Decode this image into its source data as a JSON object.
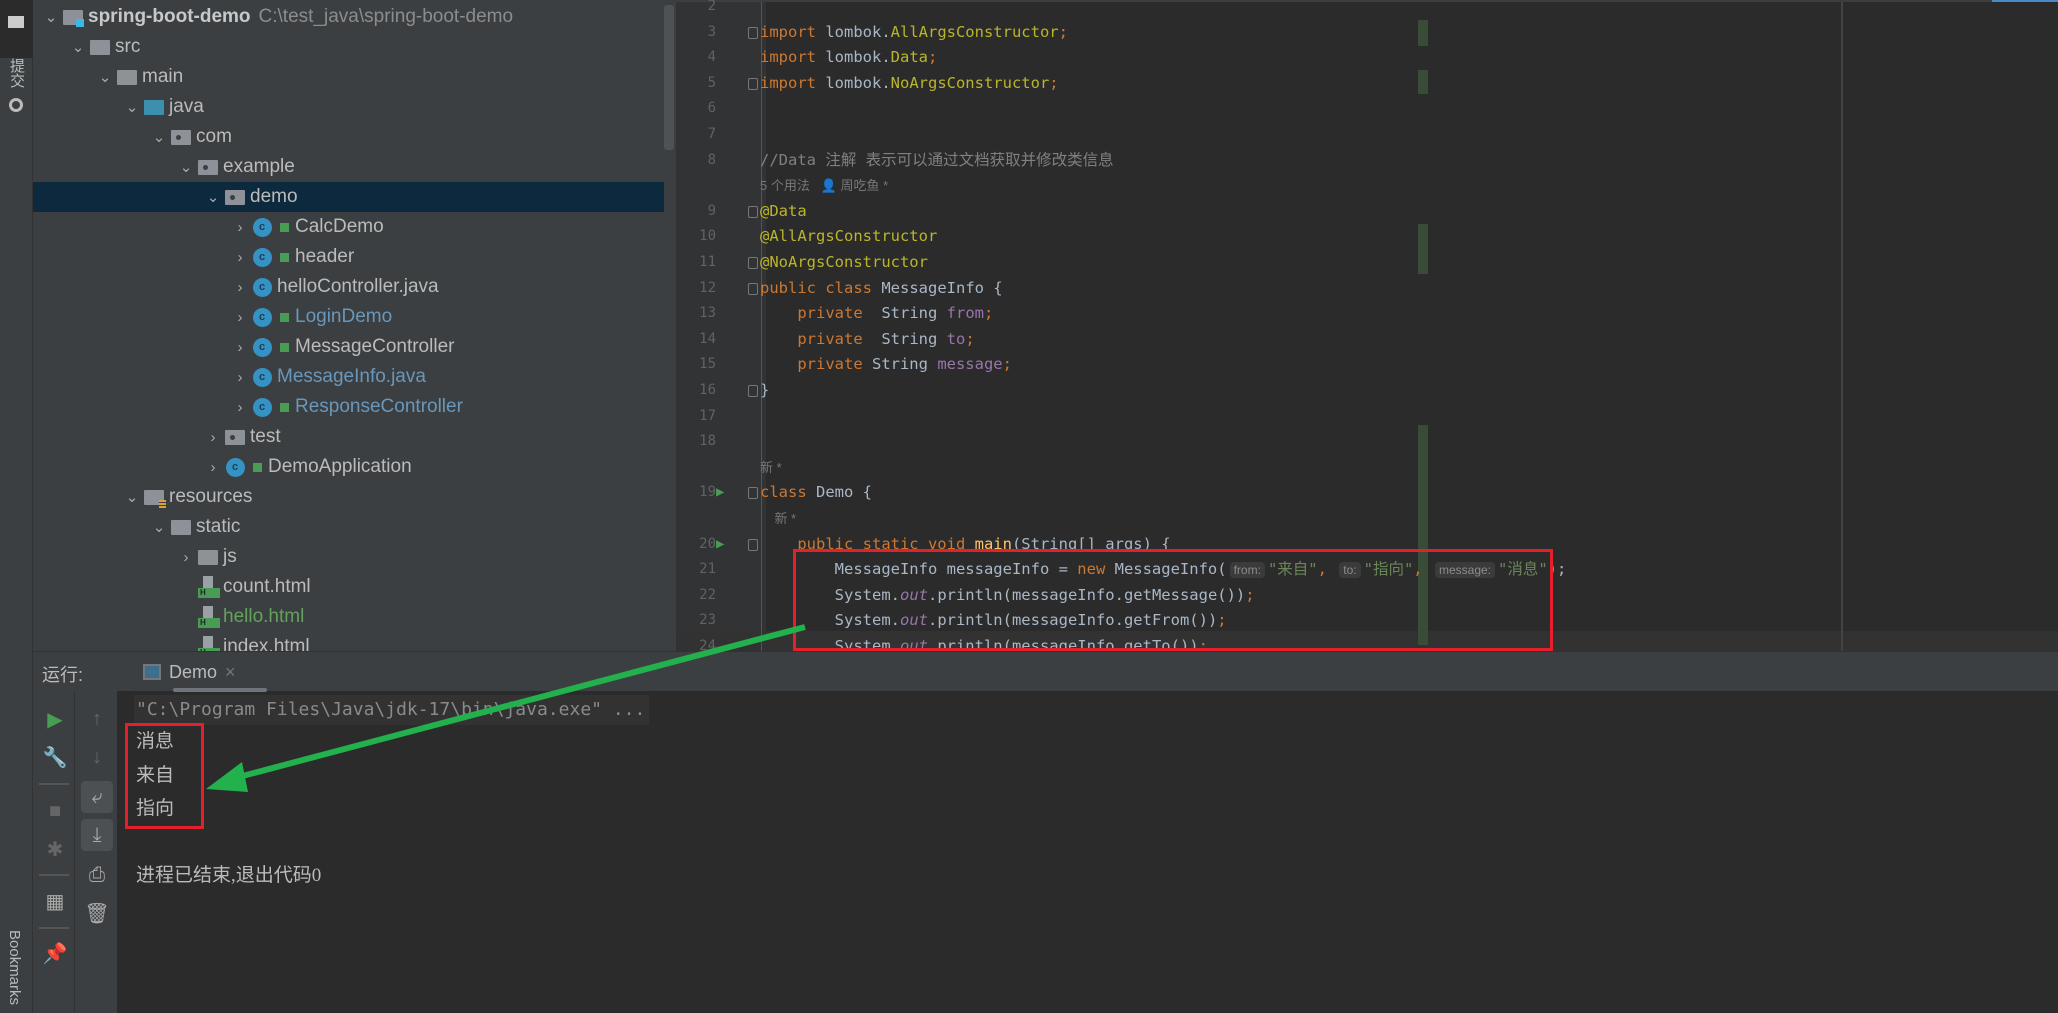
{
  "left_strip": {
    "project_label": "项目",
    "commit_label": "提交",
    "bookmarks_label": "Bookmarks"
  },
  "project": {
    "root": {
      "name": "spring-boot-demo",
      "path": "C:\\test_java\\spring-boot-demo"
    },
    "items": [
      {
        "label": "src",
        "level": 1,
        "exp": "down",
        "icon": "folder"
      },
      {
        "label": "main",
        "level": 2,
        "exp": "down",
        "icon": "folder"
      },
      {
        "label": "java",
        "level": 3,
        "exp": "down",
        "icon": "source-folder"
      },
      {
        "label": "com",
        "level": 4,
        "exp": "down",
        "icon": "package"
      },
      {
        "label": "example",
        "level": 5,
        "exp": "down",
        "icon": "package"
      },
      {
        "label": "demo",
        "level": 6,
        "exp": "down",
        "icon": "package",
        "selected": true
      },
      {
        "label": "CalcDemo",
        "level": 7,
        "exp": "right",
        "icon": "class",
        "lock": true
      },
      {
        "label": "header",
        "level": 7,
        "exp": "right",
        "icon": "class",
        "lock": true
      },
      {
        "label": "helloController.java",
        "level": 7,
        "exp": "right",
        "icon": "class"
      },
      {
        "label": "LoginDemo",
        "level": 7,
        "exp": "right",
        "icon": "class",
        "lock": true,
        "color": "#6897bb"
      },
      {
        "label": "MessageController",
        "level": 7,
        "exp": "right",
        "icon": "class",
        "lock": true
      },
      {
        "label": "MessageInfo.java",
        "level": 7,
        "exp": "right",
        "icon": "class",
        "color": "#6897bb"
      },
      {
        "label": "ResponseController",
        "level": 7,
        "exp": "right",
        "icon": "class",
        "lock": true,
        "color": "#6897bb"
      },
      {
        "label": "test",
        "level": 6,
        "exp": "right",
        "icon": "package"
      },
      {
        "label": "DemoApplication",
        "level": 6,
        "exp": "right",
        "icon": "class",
        "lock": true
      },
      {
        "label": "resources",
        "level": 3,
        "exp": "down",
        "icon": "resources-folder"
      },
      {
        "label": "static",
        "level": 4,
        "exp": "down",
        "icon": "folder"
      },
      {
        "label": "js",
        "level": 5,
        "exp": "right",
        "icon": "folder"
      },
      {
        "label": "count.html",
        "level": 5,
        "icon": "html"
      },
      {
        "label": "hello.html",
        "level": 5,
        "icon": "html",
        "color": "#62a35c"
      },
      {
        "label": "index.html",
        "level": 5,
        "icon": "html"
      }
    ]
  },
  "editor": {
    "lines": [
      {
        "num": "2",
        "tokens": []
      },
      {
        "num": "3",
        "fold": true,
        "tokens": [
          [
            "import ",
            "k"
          ],
          [
            "lombok.",
            "t"
          ],
          [
            "AllArgsConstructor",
            "a"
          ],
          [
            ";",
            "k"
          ]
        ]
      },
      {
        "num": "4",
        "tokens": [
          [
            "import ",
            "k"
          ],
          [
            "lombok.",
            "t"
          ],
          [
            "Data",
            "a"
          ],
          [
            ";",
            "k"
          ]
        ]
      },
      {
        "num": "5",
        "fold": true,
        "tokens": [
          [
            "import ",
            "k"
          ],
          [
            "lombok.",
            "t"
          ],
          [
            "NoArgsConstructor",
            "a"
          ],
          [
            ";",
            "k"
          ]
        ]
      },
      {
        "num": "6",
        "tokens": []
      },
      {
        "num": "7",
        "tokens": []
      },
      {
        "num": "8",
        "tokens": [
          [
            "//Data 注解 表示可以通过文档获取并修改类信息",
            "c"
          ]
        ]
      },
      {
        "hint": "5 个用法   👤 周吃鱼 *"
      },
      {
        "num": "9",
        "fold": true,
        "tokens": [
          [
            "@Data",
            "a"
          ]
        ]
      },
      {
        "num": "10",
        "tokens": [
          [
            "@AllArgsConstructor",
            "a"
          ]
        ]
      },
      {
        "num": "11",
        "fold": true,
        "tokens": [
          [
            "@NoArgsConstructor",
            "a"
          ]
        ]
      },
      {
        "num": "12",
        "fold": true,
        "tokens": [
          [
            "public class ",
            "k"
          ],
          [
            "MessageInfo {",
            "t"
          ]
        ]
      },
      {
        "num": "13",
        "tokens": [
          [
            "    private  ",
            "k"
          ],
          [
            "String ",
            "t"
          ],
          [
            "from",
            "f"
          ],
          [
            ";",
            "k"
          ]
        ]
      },
      {
        "num": "14",
        "tokens": [
          [
            "    private  ",
            "k"
          ],
          [
            "String ",
            "t"
          ],
          [
            "to",
            "f"
          ],
          [
            ";",
            "k"
          ]
        ]
      },
      {
        "num": "15",
        "tokens": [
          [
            "    private ",
            "k"
          ],
          [
            "String ",
            "t"
          ],
          [
            "message",
            "f"
          ],
          [
            ";",
            "k"
          ]
        ]
      },
      {
        "num": "16",
        "fold": true,
        "tokens": [
          [
            "}",
            "t"
          ]
        ]
      },
      {
        "num": "17",
        "tokens": []
      },
      {
        "num": "18",
        "tokens": []
      },
      {
        "hint": "新 *"
      },
      {
        "num": "19",
        "run": true,
        "fold": true,
        "tokens": [
          [
            "class ",
            "k"
          ],
          [
            "Demo {",
            "t"
          ]
        ]
      },
      {
        "hint": "    新 *"
      },
      {
        "num": "20",
        "run": true,
        "fold": true,
        "tokens": [
          [
            "    public static void ",
            "k"
          ],
          [
            "main",
            "m"
          ],
          [
            "(String[] args) {",
            "t"
          ]
        ]
      },
      {
        "num": "21",
        "tokens": [
          [
            "        MessageInfo messageInfo = ",
            "t"
          ],
          [
            "new ",
            "k"
          ],
          [
            "MessageInfo(",
            "t"
          ],
          [
            "from:",
            "ph"
          ],
          [
            "\"来自\"",
            "s"
          ],
          [
            ", ",
            "k"
          ],
          [
            "to:",
            "ph"
          ],
          [
            "\"指向\"",
            "s"
          ],
          [
            ", ",
            "k"
          ],
          [
            "message:",
            "ph"
          ],
          [
            "\"消息\"",
            "s"
          ],
          [
            ");",
            "t"
          ]
        ]
      },
      {
        "num": "22",
        "tokens": [
          [
            "        System.",
            "t"
          ],
          [
            "out",
            "i"
          ],
          [
            ".println(messageInfo.getMessage())",
            "t"
          ],
          [
            ";",
            "k"
          ]
        ]
      },
      {
        "num": "23",
        "tokens": [
          [
            "        System.",
            "t"
          ],
          [
            "out",
            "i"
          ],
          [
            ".println(messageInfo.getFrom())",
            "t"
          ],
          [
            ";",
            "k"
          ]
        ]
      },
      {
        "num": "24",
        "tokens": [
          [
            "        System.",
            "t"
          ],
          [
            "out",
            "i"
          ],
          [
            ".println(messageInfo.getTo())",
            "t"
          ],
          [
            ";",
            "k"
          ]
        ]
      }
    ]
  },
  "run_panel": {
    "label": "运行:",
    "tab": "Demo",
    "close": "×",
    "command": "\"C:\\Program Files\\Java\\jdk-17\\bin\\java.exe\" ...",
    "output": [
      "消息",
      "来自",
      "指向"
    ],
    "exit": "进程已结束,退出代码0"
  },
  "annotation": {
    "box_color": "#e5202a",
    "arrow_color": "#22b14c"
  }
}
